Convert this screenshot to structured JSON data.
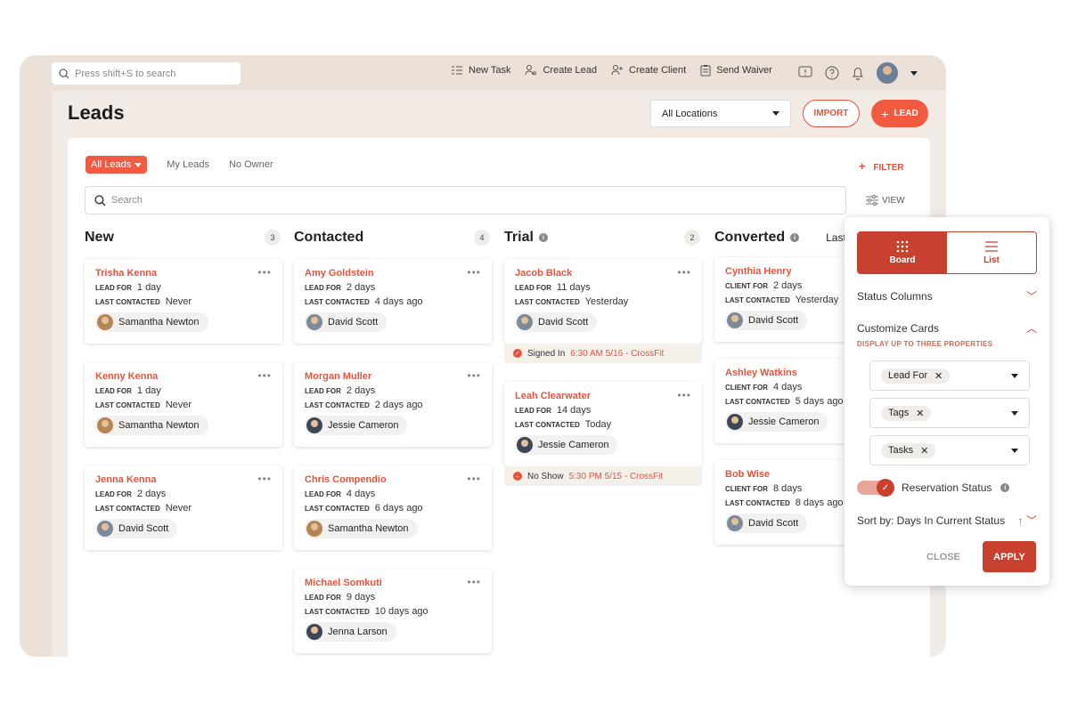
{
  "topbar": {
    "search_placeholder": "Press shift+S to search",
    "actions": [
      {
        "label": "New Task",
        "icon": "task-list-icon"
      },
      {
        "label": "Create Lead",
        "icon": "user-star-icon"
      },
      {
        "label": "Create Client",
        "icon": "user-add-icon"
      },
      {
        "label": "Send Waiver",
        "icon": "clipboard-icon"
      }
    ]
  },
  "header": {
    "title": "Leads",
    "location": "All Locations",
    "import_label": "IMPORT",
    "lead_label": "LEAD"
  },
  "filters": {
    "tabs": [
      "All Leads",
      "My Leads",
      "No Owner"
    ],
    "filter_label": "FILTER",
    "search_placeholder": "Search",
    "view_label": "VIEW"
  },
  "columns": [
    {
      "title": "New",
      "count": "3",
      "cards": [
        {
          "name": "Trisha Kenna",
          "lbl1": "LEAD FOR",
          "val1": "1 day",
          "lbl2": "LAST CONTACTED",
          "val2": "Never",
          "owner": "Samantha Newton"
        },
        {
          "name": "Kenny Kenna",
          "lbl1": "LEAD FOR",
          "val1": "1 day",
          "lbl2": "LAST CONTACTED",
          "val2": "Never",
          "owner": "Samantha Newton"
        },
        {
          "name": "Jenna Kenna",
          "lbl1": "LEAD FOR",
          "val1": "2 days",
          "lbl2": "LAST CONTACTED",
          "val2": "Never",
          "owner": "David Scott"
        }
      ]
    },
    {
      "title": "Contacted",
      "count": "4",
      "cards": [
        {
          "name": "Amy Goldstein",
          "lbl1": "LEAD FOR",
          "val1": "2 days",
          "lbl2": "LAST CONTACTED",
          "val2": "4 days ago",
          "owner": "David Scott"
        },
        {
          "name": "Morgan Muller",
          "lbl1": "LEAD FOR",
          "val1": "2 days",
          "lbl2": "LAST CONTACTED",
          "val2": "2 days ago",
          "owner": "Jessie Cameron"
        },
        {
          "name": "Chris Compendio",
          "lbl1": "LEAD FOR",
          "val1": "4 days",
          "lbl2": "LAST CONTACTED",
          "val2": "6 days ago",
          "owner": "Samantha Newton"
        },
        {
          "name": "Michael Somkuti",
          "lbl1": "LEAD FOR",
          "val1": "9 days",
          "lbl2": "LAST CONTACTED",
          "val2": "10 days ago",
          "owner": "Jenna Larson"
        }
      ]
    },
    {
      "title": "Trial",
      "count": "2",
      "cards": [
        {
          "name": "Jacob Black",
          "lbl1": "LEAD FOR",
          "val1": "11 days",
          "lbl2": "LAST CONTACTED",
          "val2": "Yesterday",
          "owner": "David Scott",
          "status": "Signed In",
          "status_detail": "6:30 AM 5/16 - CrossFit"
        },
        {
          "name": "Leah Clearwater",
          "lbl1": "LEAD FOR",
          "val1": "14 days",
          "lbl2": "LAST CONTACTED",
          "val2": "Today",
          "owner": "Jessie Cameron",
          "status": "No Show",
          "status_detail": "5:30 PM 5/15 - CrossFit"
        }
      ]
    },
    {
      "title": "Converted",
      "extra": "Last",
      "cards": [
        {
          "name": "Cynthia Henry",
          "lbl1": "CLIENT FOR",
          "val1": "2 days",
          "lbl2": "LAST CONTACTED",
          "val2": "Yesterday",
          "owner": "David Scott"
        },
        {
          "name": "Ashley Watkins",
          "lbl1": "CLIENT FOR",
          "val1": "4 days",
          "lbl2": "LAST CONTACTED",
          "val2": "5 days ago",
          "owner": "Jessie Cameron"
        },
        {
          "name": "Bob Wise",
          "lbl1": "CLIENT FOR",
          "val1": "8 days",
          "lbl2": "LAST CONTACTED",
          "val2": "8 days ago",
          "owner": "David Scott"
        }
      ]
    }
  ],
  "view_popup": {
    "board_label": "Board",
    "list_label": "List",
    "status_columns": "Status Columns",
    "customize_cards": "Customize Cards",
    "display_hint": "DISPLAY UP TO THREE PROPERTIES",
    "properties": [
      "Lead For",
      "Tags",
      "Tasks"
    ],
    "reservation_status": "Reservation Status",
    "sort_by": "Sort by: Days In Current Status",
    "close_label": "CLOSE",
    "apply_label": "APPLY"
  },
  "colors": {
    "accent": "#f25a42",
    "dark_accent": "#c8402e",
    "frame": "#ebe1d8"
  }
}
